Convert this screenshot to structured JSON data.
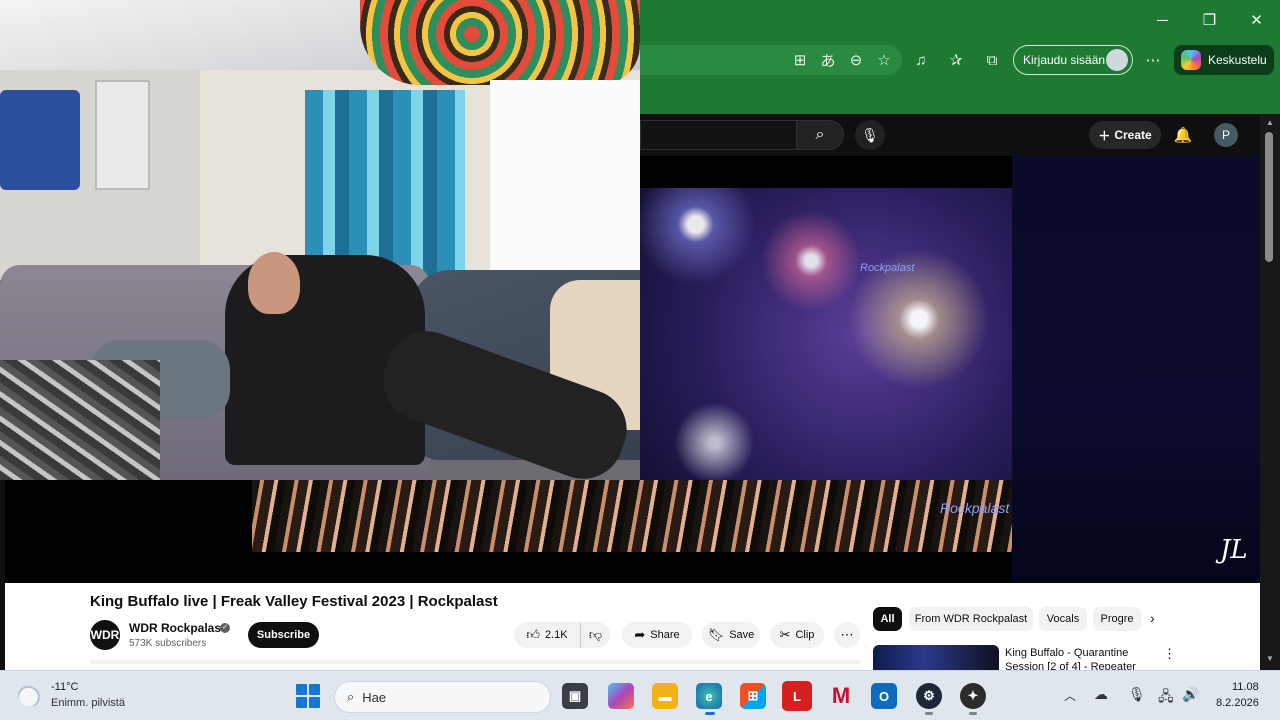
{
  "browser": {
    "window_controls": {
      "minimize": "─",
      "maximize": "❐",
      "close": "✕"
    },
    "signin_label": "Kirjaudu sisään",
    "copilot_label": "Keskustelu",
    "accent": "#1e7a33"
  },
  "youtube": {
    "create_label": "Create",
    "avatar_letter": "P",
    "video": {
      "title": "King Buffalo live | Freak Valley Festival 2023 | Rockpalast",
      "overlay_logo": "Rockpalast",
      "watermark": "JL"
    },
    "channel": {
      "avatar_text": "WDR",
      "name": "WDR Rockpalast",
      "subscribers": "573K subscribers",
      "subscribe_label": "Subscribe"
    },
    "actions": {
      "likes": "2.1K",
      "share": "Share",
      "save": "Save",
      "clip": "Clip"
    },
    "chips": [
      "All",
      "From WDR Rockpalast",
      "Vocals",
      "Progre"
    ],
    "recommendation": {
      "title": "King Buffalo - Quarantine Session [2 of 4] - Repeater"
    }
  },
  "taskbar": {
    "weather_temp": "-11°C",
    "weather_desc": "Enimm. pilvistä",
    "search_placeholder": "Hae",
    "time": "11.08",
    "date": "8.2.2026"
  }
}
